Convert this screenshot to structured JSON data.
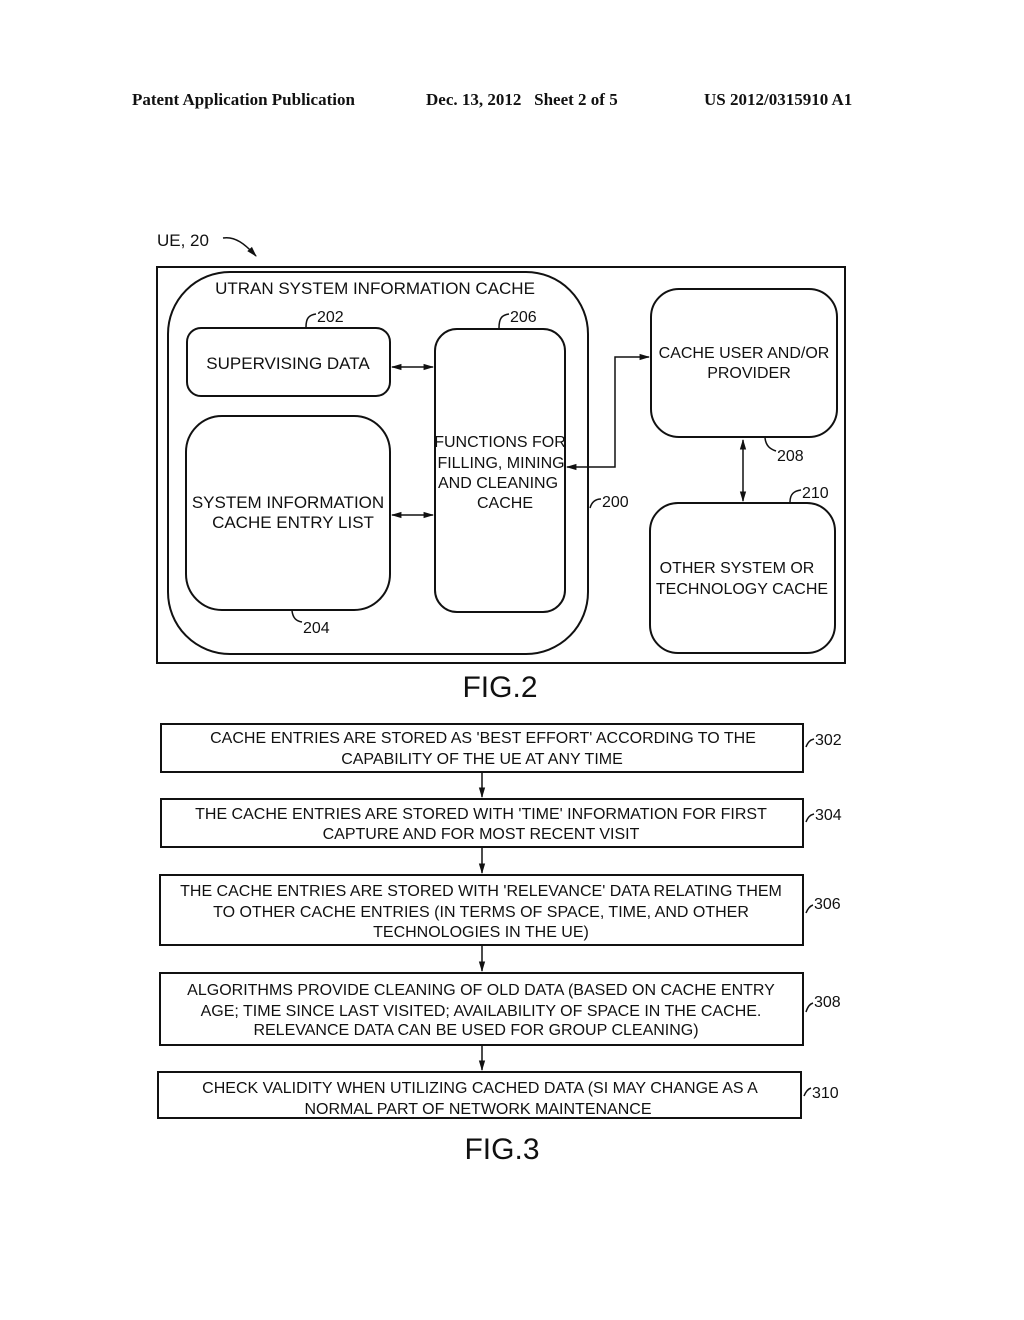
{
  "header": {
    "publication": "Patent Application Publication",
    "date_sheet": "Dec. 13, 2012   Sheet 2 of 5",
    "patent_number": "US 2012/0315910 A1"
  },
  "fig2": {
    "ue_label": "UE, 20",
    "outer_ref": "200",
    "cache_title": "UTRAN SYSTEM INFORMATION CACHE",
    "supervising": {
      "ref": "202",
      "lines": [
        "SUPERVISING DATA"
      ]
    },
    "entry_list": {
      "ref": "204",
      "lines": [
        "SYSTEM INFORMATION",
        "CACHE ENTRY LIST"
      ]
    },
    "functions": {
      "ref": "206",
      "lines": [
        "FUNCTIONS FOR",
        "FILLING, MINING",
        "AND CLEANING",
        "CACHE"
      ]
    },
    "cache_user": {
      "ref": "208",
      "lines": [
        "CACHE USER AND/OR",
        "PROVIDER"
      ]
    },
    "other_cache": {
      "ref": "210",
      "lines": [
        "OTHER SYSTEM OR",
        "TECHNOLOGY CACHE"
      ]
    },
    "caption": "FIG.2"
  },
  "fig3": {
    "steps": [
      {
        "ref": "302",
        "lines": [
          "CACHE ENTRIES ARE STORED AS 'BEST EFFORT' ACCORDING TO THE",
          "CAPABILITY OF THE UE AT ANY TIME"
        ]
      },
      {
        "ref": "304",
        "lines": [
          "THE CACHE ENTRIES ARE STORED WITH 'TIME' INFORMATION FOR FIRST",
          "CAPTURE AND FOR MOST RECENT VISIT"
        ]
      },
      {
        "ref": "306",
        "lines": [
          "THE CACHE ENTRIES ARE STORED WITH 'RELEVANCE' DATA RELATING THEM",
          "TO OTHER CACHE ENTRIES (IN TERMS OF SPACE, TIME, AND OTHER",
          "TECHNOLOGIES IN THE UE)"
        ]
      },
      {
        "ref": "308",
        "lines": [
          "ALGORITHMS PROVIDE CLEANING OF OLD DATA (BASED ON CACHE ENTRY",
          "AGE; TIME SINCE LAST VISITED; AVAILABILITY OF SPACE IN THE CACHE.",
          "RELEVANCE DATA CAN BE USED FOR GROUP CLEANING)"
        ]
      },
      {
        "ref": "310",
        "lines": [
          "CHECK VALIDITY WHEN UTILIZING CACHED DATA (SI MAY CHANGE AS A",
          "NORMAL PART OF NETWORK MAINTENANCE"
        ]
      }
    ],
    "caption": "FIG.3"
  }
}
